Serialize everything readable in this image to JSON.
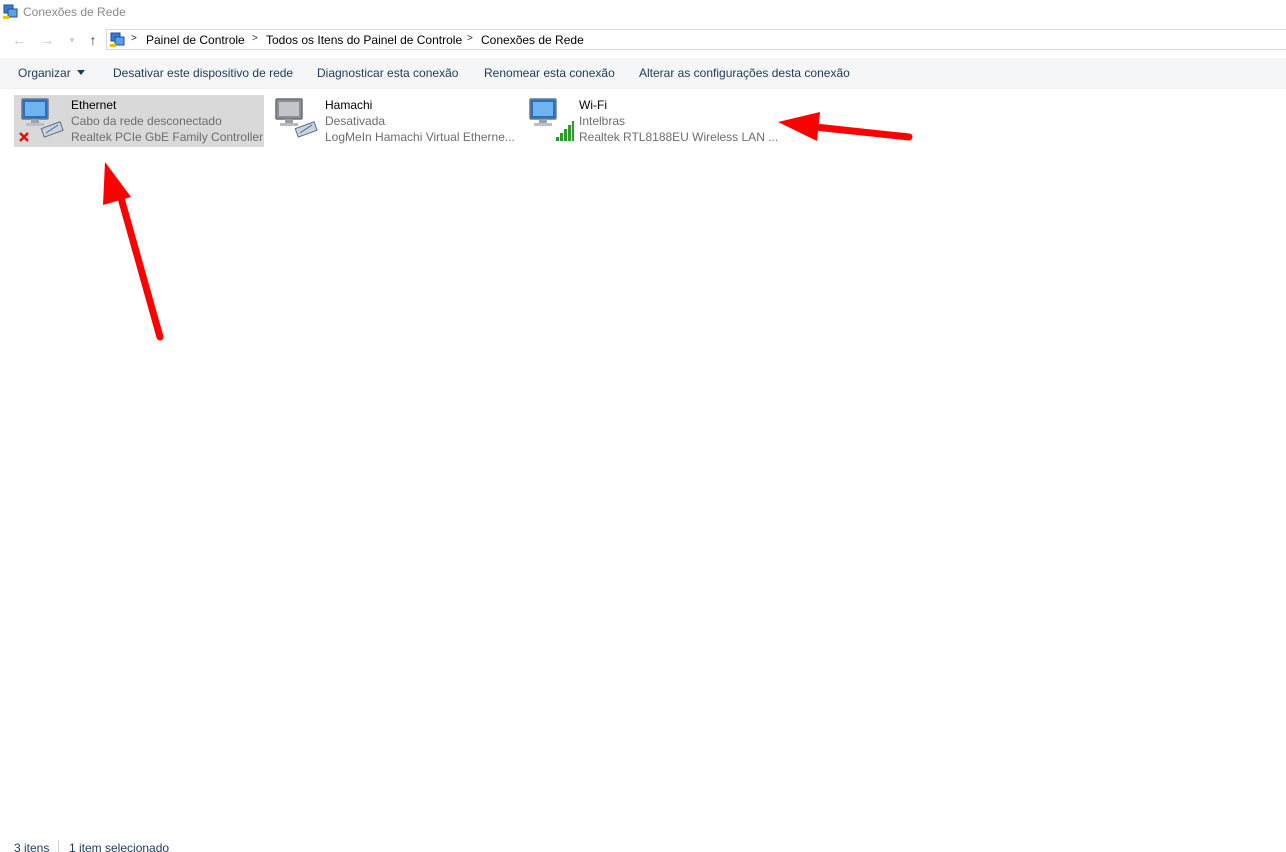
{
  "window": {
    "title": "Conexões de Rede",
    "icon": "network-connections-icon"
  },
  "navigation": {
    "back_icon": "arrow-left-icon",
    "forward_icon": "arrow-right-icon",
    "recent_icon": "chevron-down-icon",
    "up_icon": "arrow-up-icon",
    "breadcrumb": [
      "Painel de Controle",
      "Todos os Itens do Painel de Controle",
      "Conexões de Rede"
    ]
  },
  "toolbar": {
    "organize": "Organizar",
    "disable": "Desativar este dispositivo de rede",
    "diagnose": "Diagnosticar esta conexão",
    "rename": "Renomear esta conexão",
    "change_settings": "Alterar as configurações desta conexão"
  },
  "connections": [
    {
      "name": "Ethernet",
      "status": "Cabo da rede desconectado",
      "device": "Realtek PCIe GbE Family Controller",
      "icon": "ethernet-disconnected-icon",
      "selected": true
    },
    {
      "name": "Hamachi",
      "status": "Desativada",
      "device": "LogMeIn Hamachi Virtual Etherne...",
      "icon": "network-adapter-disabled-icon",
      "selected": false
    },
    {
      "name": "Wi-Fi",
      "status": "Intelbras",
      "device": "Realtek RTL8188EU Wireless LAN ...",
      "icon": "wifi-signal-icon",
      "selected": false
    }
  ],
  "statusbar": {
    "count": "3 itens",
    "selection": "1 item selecionado"
  },
  "colors": {
    "selection": "#d9d9d9",
    "command_text": "#1e395b",
    "annotation_arrow": "#ff0000"
  }
}
